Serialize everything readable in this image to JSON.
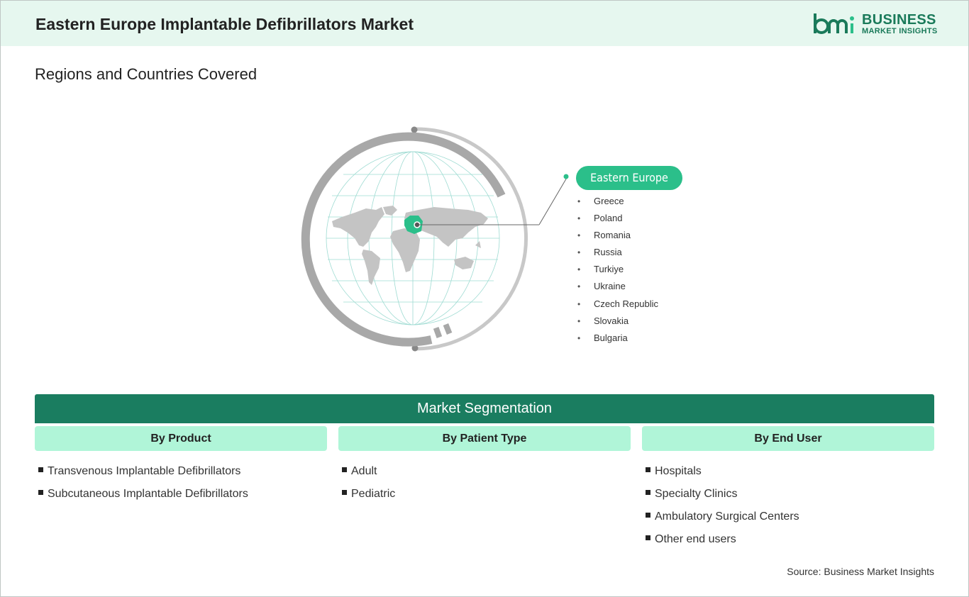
{
  "header": {
    "title": "Eastern Europe Implantable Defibrillators Market",
    "logo_line1": "BUSINESS",
    "logo_line2": "MARKET INSIGHTS",
    "brand_color": "#1a7a5a"
  },
  "section_title": "Regions and Countries Covered",
  "region": {
    "name": "Eastern Europe",
    "accent_color": "#2bbf8a",
    "countries": [
      "Greece",
      "Poland",
      "Romania",
      "Russia",
      "Turkiye",
      "Ukraine",
      "Czech Republic",
      "Slovakia",
      "Bulgaria"
    ]
  },
  "segmentation": {
    "title": "Market Segmentation",
    "columns": [
      {
        "heading": "By Product",
        "items": [
          "Transvenous Implantable Defibrillators",
          "Subcutaneous Implantable Defibrillators"
        ]
      },
      {
        "heading": "By Patient Type",
        "items": [
          "Adult",
          "Pediatric"
        ]
      },
      {
        "heading": "By End User",
        "items": [
          "Hospitals",
          "Specialty Clinics",
          "Ambulatory Surgical Centers",
          "Other end users"
        ]
      }
    ]
  },
  "source": "Source: Business Market Insights"
}
